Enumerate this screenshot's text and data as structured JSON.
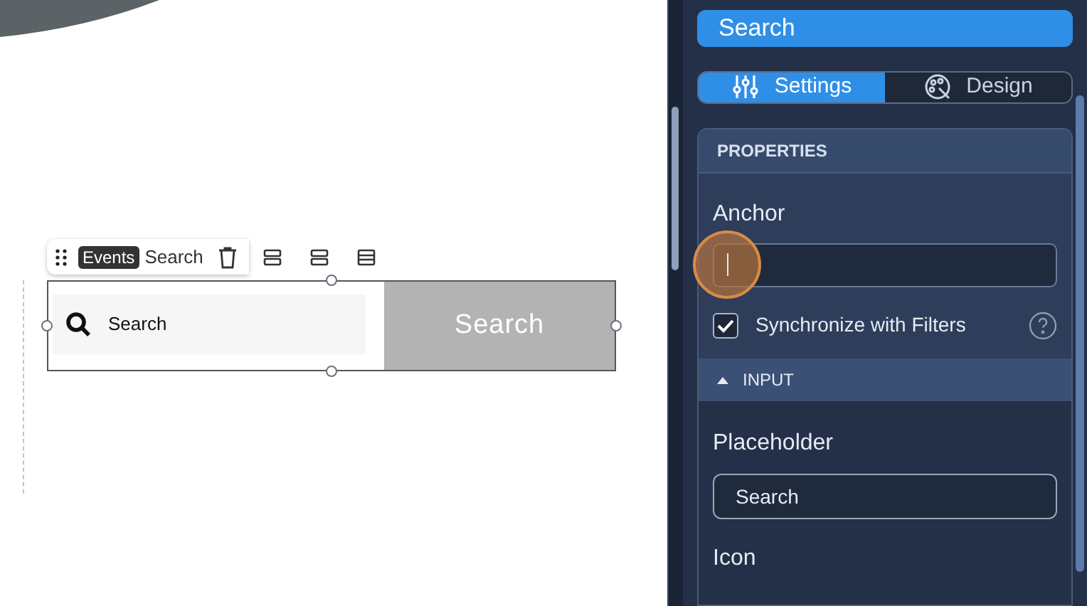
{
  "canvas": {
    "toolbar": {
      "badge": "Events",
      "label": "Search"
    },
    "widget": {
      "input_text": "Search",
      "button": "Search"
    }
  },
  "panel": {
    "title": "Search",
    "tabs": [
      {
        "label": "Settings",
        "selected": true
      },
      {
        "label": "Design",
        "selected": false
      }
    ],
    "properties": {
      "header": "PROPERTIES",
      "anchor_label": "Anchor",
      "sync": {
        "label": "Synchronize with Filters",
        "checked": true
      }
    },
    "input_section": {
      "header": "INPUT",
      "expanded": true,
      "placeholder_label": "Placeholder",
      "placeholder_value": "Search",
      "icon_label": "Icon"
    }
  }
}
